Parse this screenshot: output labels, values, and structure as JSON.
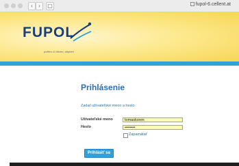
{
  "browser": {
    "back_label": "‹",
    "forward_label": "›",
    "sidebar_label": "▢",
    "address": "fupol-6.cellent.at"
  },
  "header": {
    "logo_text": "FUPOL",
    "logo_tagline": "politics & citizen, aligned",
    "brand_color": "#1a3e7a",
    "accent_color": "#2fa2db"
  },
  "login": {
    "title": "Prihlásenie",
    "subtitle": "Zadať užívateľské meno a heslo",
    "username_label": "Užívateľské meno",
    "username_value": "tomaskoren",
    "password_label": "Heslo",
    "password_value": "••••••••",
    "remember_label": "Zapamätať",
    "submit_label": "Prihlásiť sa"
  }
}
